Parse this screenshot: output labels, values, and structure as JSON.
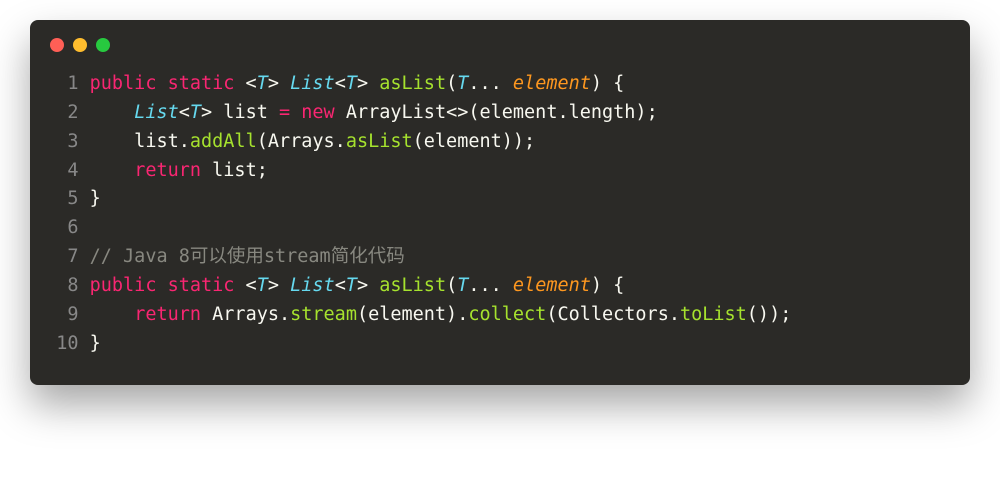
{
  "titlebar": {
    "buttons": [
      "close",
      "minimize",
      "zoom"
    ]
  },
  "code": {
    "lines": [
      {
        "num": "1",
        "tokens": [
          {
            "cls": "tok-kw",
            "t": "public"
          },
          {
            "cls": "tok-plain",
            "t": " "
          },
          {
            "cls": "tok-kw",
            "t": "static"
          },
          {
            "cls": "tok-plain",
            "t": " <"
          },
          {
            "cls": "tok-type",
            "t": "T"
          },
          {
            "cls": "tok-plain",
            "t": "> "
          },
          {
            "cls": "tok-type",
            "t": "List"
          },
          {
            "cls": "tok-plain",
            "t": "<"
          },
          {
            "cls": "tok-type",
            "t": "T"
          },
          {
            "cls": "tok-plain",
            "t": "> "
          },
          {
            "cls": "tok-fn",
            "t": "asList"
          },
          {
            "cls": "tok-plain",
            "t": "("
          },
          {
            "cls": "tok-type",
            "t": "T"
          },
          {
            "cls": "tok-plain",
            "t": "... "
          },
          {
            "cls": "tok-param",
            "t": "element"
          },
          {
            "cls": "tok-plain",
            "t": ") {"
          }
        ]
      },
      {
        "num": "2",
        "tokens": [
          {
            "cls": "tok-plain",
            "t": "    "
          },
          {
            "cls": "tok-type",
            "t": "List"
          },
          {
            "cls": "tok-plain",
            "t": "<"
          },
          {
            "cls": "tok-type",
            "t": "T"
          },
          {
            "cls": "tok-plain",
            "t": "> list "
          },
          {
            "cls": "tok-kw",
            "t": "="
          },
          {
            "cls": "tok-plain",
            "t": " "
          },
          {
            "cls": "tok-kw",
            "t": "new"
          },
          {
            "cls": "tok-plain",
            "t": " ArrayList<>(element.length);"
          }
        ]
      },
      {
        "num": "3",
        "tokens": [
          {
            "cls": "tok-plain",
            "t": "    list."
          },
          {
            "cls": "tok-fn",
            "t": "addAll"
          },
          {
            "cls": "tok-plain",
            "t": "(Arrays."
          },
          {
            "cls": "tok-fn",
            "t": "asList"
          },
          {
            "cls": "tok-plain",
            "t": "(element));"
          }
        ]
      },
      {
        "num": "4",
        "tokens": [
          {
            "cls": "tok-plain",
            "t": "    "
          },
          {
            "cls": "tok-kw",
            "t": "return"
          },
          {
            "cls": "tok-plain",
            "t": " list;"
          }
        ]
      },
      {
        "num": "5",
        "tokens": [
          {
            "cls": "tok-plain",
            "t": "}"
          }
        ]
      },
      {
        "num": "6",
        "tokens": [
          {
            "cls": "tok-plain",
            "t": ""
          }
        ]
      },
      {
        "num": "7",
        "tokens": [
          {
            "cls": "tok-comment",
            "t": "// Java 8可以使用stream简化代码"
          }
        ]
      },
      {
        "num": "8",
        "tokens": [
          {
            "cls": "tok-kw",
            "t": "public"
          },
          {
            "cls": "tok-plain",
            "t": " "
          },
          {
            "cls": "tok-kw",
            "t": "static"
          },
          {
            "cls": "tok-plain",
            "t": " <"
          },
          {
            "cls": "tok-type",
            "t": "T"
          },
          {
            "cls": "tok-plain",
            "t": "> "
          },
          {
            "cls": "tok-type",
            "t": "List"
          },
          {
            "cls": "tok-plain",
            "t": "<"
          },
          {
            "cls": "tok-type",
            "t": "T"
          },
          {
            "cls": "tok-plain",
            "t": "> "
          },
          {
            "cls": "tok-fn",
            "t": "asList"
          },
          {
            "cls": "tok-plain",
            "t": "("
          },
          {
            "cls": "tok-type",
            "t": "T"
          },
          {
            "cls": "tok-plain",
            "t": "... "
          },
          {
            "cls": "tok-param",
            "t": "element"
          },
          {
            "cls": "tok-plain",
            "t": ") {"
          }
        ]
      },
      {
        "num": "9",
        "tokens": [
          {
            "cls": "tok-plain",
            "t": "    "
          },
          {
            "cls": "tok-kw",
            "t": "return"
          },
          {
            "cls": "tok-plain",
            "t": " Arrays."
          },
          {
            "cls": "tok-fn",
            "t": "stream"
          },
          {
            "cls": "tok-plain",
            "t": "(element)."
          },
          {
            "cls": "tok-fn",
            "t": "collect"
          },
          {
            "cls": "tok-plain",
            "t": "(Collectors."
          },
          {
            "cls": "tok-fn",
            "t": "toList"
          },
          {
            "cls": "tok-plain",
            "t": "());"
          }
        ]
      },
      {
        "num": "10",
        "tokens": [
          {
            "cls": "tok-plain",
            "t": "}"
          }
        ]
      }
    ]
  }
}
